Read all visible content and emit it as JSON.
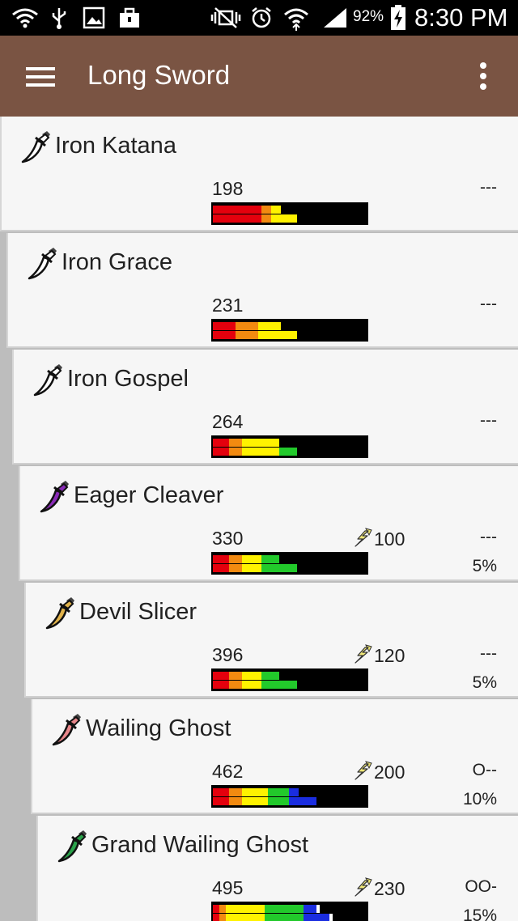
{
  "status_bar": {
    "battery_percent": "92%",
    "time": "8:30 PM"
  },
  "app_bar": {
    "title": "Long Sword"
  },
  "colors": {
    "app_bar": "#7a5443",
    "red": "#e4000d",
    "orange": "#f28a10",
    "yellow": "#fff200",
    "green": "#22c92b",
    "blue": "#1a2de0",
    "white": "#ffffff"
  },
  "weapons": [
    {
      "name": "Iron Katana",
      "attack": "198",
      "element": "",
      "slots": "---",
      "affinity": "",
      "icon_color": "#ffffff",
      "sharpness": {
        "top": [
          [
            "red",
            30
          ],
          [
            "orange",
            6
          ],
          [
            "yellow",
            6
          ]
        ],
        "bottom": [
          [
            "red",
            30
          ],
          [
            "orange",
            6
          ],
          [
            "yellow",
            16
          ]
        ]
      }
    },
    {
      "name": "Iron Grace",
      "attack": "231",
      "element": "",
      "slots": "---",
      "affinity": "",
      "icon_color": "#ffffff",
      "sharpness": {
        "top": [
          [
            "red",
            14
          ],
          [
            "orange",
            14
          ],
          [
            "yellow",
            14
          ]
        ],
        "bottom": [
          [
            "red",
            14
          ],
          [
            "orange",
            14
          ],
          [
            "yellow",
            24
          ]
        ]
      }
    },
    {
      "name": "Iron Gospel",
      "attack": "264",
      "element": "",
      "slots": "---",
      "affinity": "",
      "icon_color": "#ffffff",
      "sharpness": {
        "top": [
          [
            "red",
            10
          ],
          [
            "orange",
            8
          ],
          [
            "yellow",
            23
          ]
        ],
        "bottom": [
          [
            "red",
            10
          ],
          [
            "orange",
            8
          ],
          [
            "yellow",
            23
          ],
          [
            "green",
            11
          ]
        ]
      }
    },
    {
      "name": "Eager Cleaver",
      "attack": "330",
      "element": "100",
      "element_icon": "thunder-icon",
      "slots": "---",
      "affinity": "5%",
      "icon_color": "#8a2bb8",
      "sharpness": {
        "top": [
          [
            "red",
            10
          ],
          [
            "orange",
            8
          ],
          [
            "yellow",
            12
          ],
          [
            "green",
            11
          ]
        ],
        "bottom": [
          [
            "red",
            10
          ],
          [
            "orange",
            8
          ],
          [
            "yellow",
            12
          ],
          [
            "green",
            22
          ]
        ]
      }
    },
    {
      "name": "Devil Slicer",
      "attack": "396",
      "element": "120",
      "element_icon": "thunder-icon",
      "slots": "---",
      "affinity": "5%",
      "icon_color": "#e0b24a",
      "sharpness": {
        "top": [
          [
            "red",
            10
          ],
          [
            "orange",
            8
          ],
          [
            "yellow",
            12
          ],
          [
            "green",
            11
          ]
        ],
        "bottom": [
          [
            "red",
            10
          ],
          [
            "orange",
            8
          ],
          [
            "yellow",
            12
          ],
          [
            "green",
            22
          ]
        ]
      }
    },
    {
      "name": "Wailing Ghost",
      "attack": "462",
      "element": "200",
      "element_icon": "thunder-icon",
      "slots": "O--",
      "affinity": "10%",
      "icon_color": "#e8868a",
      "sharpness": {
        "top": [
          [
            "red",
            10
          ],
          [
            "orange",
            8
          ],
          [
            "yellow",
            16
          ],
          [
            "green",
            13
          ],
          [
            "blue",
            6
          ]
        ],
        "bottom": [
          [
            "red",
            10
          ],
          [
            "orange",
            8
          ],
          [
            "yellow",
            16
          ],
          [
            "green",
            13
          ],
          [
            "blue",
            17
          ]
        ]
      }
    },
    {
      "name": "Grand Wailing Ghost",
      "attack": "495",
      "element": "230",
      "element_icon": "thunder-icon",
      "slots": "OO-",
      "affinity": "15%",
      "icon_color": "#2aa14a",
      "sharpness": {
        "top": [
          [
            "red",
            4
          ],
          [
            "orange",
            4
          ],
          [
            "yellow",
            24
          ],
          [
            "green",
            24
          ],
          [
            "blue",
            8
          ],
          [
            "white",
            2
          ]
        ],
        "bottom": [
          [
            "red",
            4
          ],
          [
            "orange",
            4
          ],
          [
            "yellow",
            24
          ],
          [
            "green",
            24
          ],
          [
            "blue",
            16
          ],
          [
            "white",
            2
          ]
        ]
      }
    }
  ]
}
